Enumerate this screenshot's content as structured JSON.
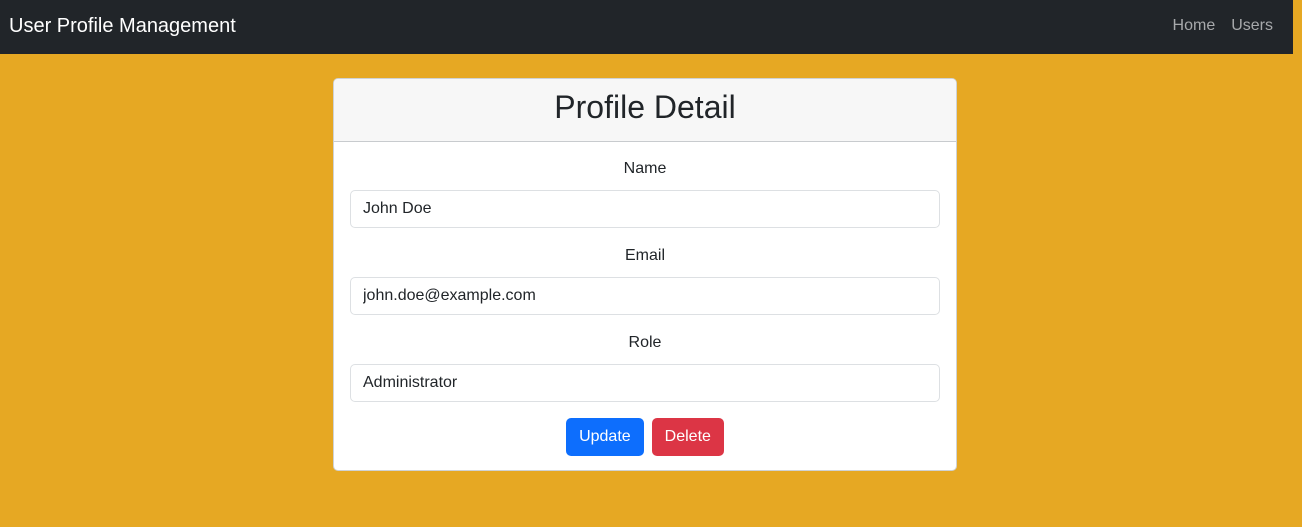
{
  "navbar": {
    "brand": "User Profile Management",
    "links": [
      {
        "label": "Home"
      },
      {
        "label": "Users"
      }
    ]
  },
  "card": {
    "title": "Profile Detail",
    "fields": {
      "name": {
        "label": "Name",
        "value": "John Doe"
      },
      "email": {
        "label": "Email",
        "value": "john.doe@example.com"
      },
      "role": {
        "label": "Role",
        "value": "Administrator"
      }
    },
    "actions": {
      "update_label": "Update",
      "delete_label": "Delete"
    }
  },
  "colors": {
    "page_background": "#e6a823",
    "navbar_background": "#212529",
    "primary": "#0d6efd",
    "danger": "#dc3545"
  }
}
